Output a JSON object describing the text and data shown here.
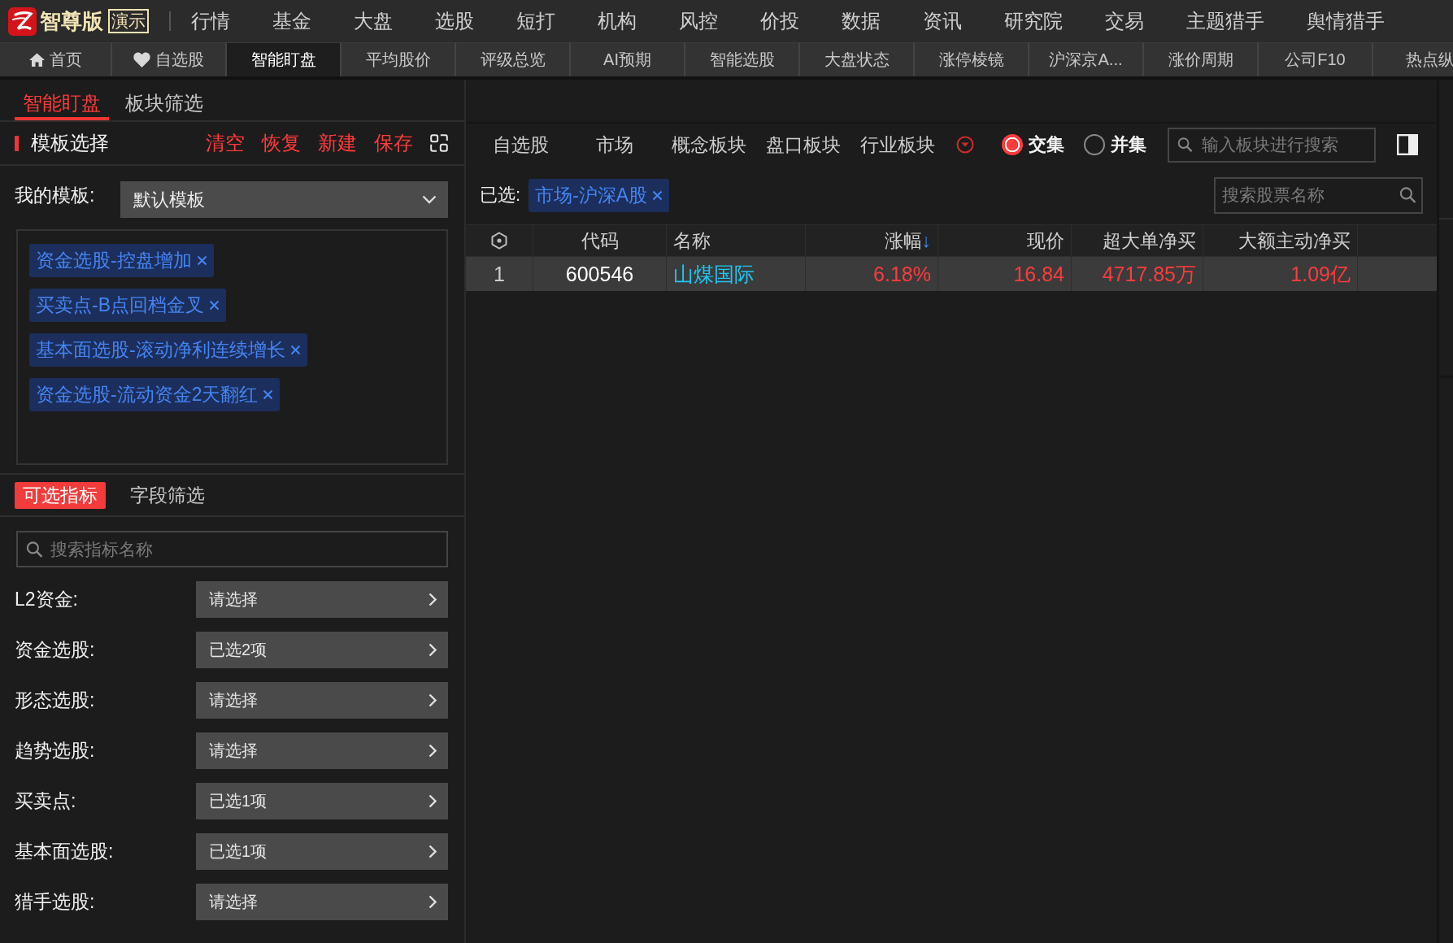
{
  "app_bar": {
    "brand": "智尊版",
    "edition_badge": "演示",
    "menu": [
      "行情",
      "基金",
      "大盘",
      "选股",
      "短打",
      "机构",
      "风控",
      "价投",
      "数据",
      "资讯",
      "研究院",
      "交易",
      "主题猎手",
      "舆情猎手"
    ]
  },
  "page_tabs": [
    {
      "label": "首页",
      "kind": "home",
      "selected": false
    },
    {
      "label": "自选股",
      "kind": "favorite",
      "selected": false
    },
    {
      "label": "智能盯盘",
      "kind": "plain",
      "selected": true
    },
    {
      "label": "平均股价",
      "kind": "plain",
      "selected": false
    },
    {
      "label": "评级总览",
      "kind": "plain",
      "selected": false
    },
    {
      "label": "AI预期",
      "kind": "plain",
      "selected": false
    },
    {
      "label": "智能选股",
      "kind": "plain",
      "selected": false
    },
    {
      "label": "大盘状态",
      "kind": "plain",
      "selected": false
    },
    {
      "label": "涨停棱镜",
      "kind": "plain",
      "selected": false
    },
    {
      "label": "沪深京A...",
      "kind": "plain",
      "selected": false
    },
    {
      "label": "涨价周期",
      "kind": "plain",
      "selected": false
    },
    {
      "label": "公司F10",
      "kind": "plain",
      "selected": false
    },
    {
      "label": "热点纵",
      "kind": "plain",
      "selected": false
    }
  ],
  "sub_tabs": [
    {
      "label": "智能盯盘",
      "selected": true
    },
    {
      "label": "板块筛选",
      "selected": false
    }
  ],
  "template_panel": {
    "title": "模板选择",
    "actions": [
      "清空",
      "恢复",
      "新建",
      "保存"
    ],
    "template_label": "我的模板:",
    "template_value": "默认模板",
    "tags": [
      "资金选股-控盘增加",
      "买卖点-B点回档金叉",
      "基本面选股-滚动净利连续增长",
      "资金选股-流动资金2天翻红"
    ]
  },
  "indicator_panel": {
    "tabs": [
      {
        "label": "可选指标",
        "selected": true
      },
      {
        "label": "字段筛选",
        "selected": false
      }
    ],
    "search": {
      "placeholder": "搜索指标名称"
    },
    "filters": [
      {
        "label": "L2资金:",
        "value": "请选择"
      },
      {
        "label": "资金选股:",
        "value": "已选2项"
      },
      {
        "label": "形态选股:",
        "value": "请选择"
      },
      {
        "label": "趋势选股:",
        "value": "请选择"
      },
      {
        "label": "买卖点:",
        "value": "已选1项"
      },
      {
        "label": "基本面选股:",
        "value": "已选1项"
      },
      {
        "label": "猎手选股:",
        "value": "请选择"
      }
    ]
  },
  "market_panel": {
    "tabs": [
      "自选股",
      "市场",
      "概念板块",
      "盘口板块",
      "行业板块"
    ],
    "modes": [
      {
        "label": "交集",
        "selected": true
      },
      {
        "label": "并集",
        "selected": false
      }
    ],
    "search": {
      "placeholder": "输入板块进行搜索"
    }
  },
  "selection": {
    "label": "已选:",
    "tags": [
      "市场-沪深A股"
    ],
    "search": {
      "placeholder": "搜索股票名称"
    }
  },
  "table": {
    "columns": [
      {
        "kind": "index"
      },
      {
        "kind": "code",
        "label": "代码"
      },
      {
        "kind": "name",
        "label": "名称"
      },
      {
        "kind": "number",
        "label": "涨幅",
        "sort_mark": "↓"
      },
      {
        "kind": "number",
        "label": "现价"
      },
      {
        "kind": "number",
        "label": "超大单净买"
      },
      {
        "kind": "number",
        "label": "大额主动净买"
      }
    ],
    "rows": [
      {
        "selected": true,
        "rising": true,
        "cells": [
          "1",
          "600546",
          "山煤国际",
          "6.18%",
          "16.84",
          "4717.85万",
          "1.09亿"
        ]
      }
    ]
  }
}
